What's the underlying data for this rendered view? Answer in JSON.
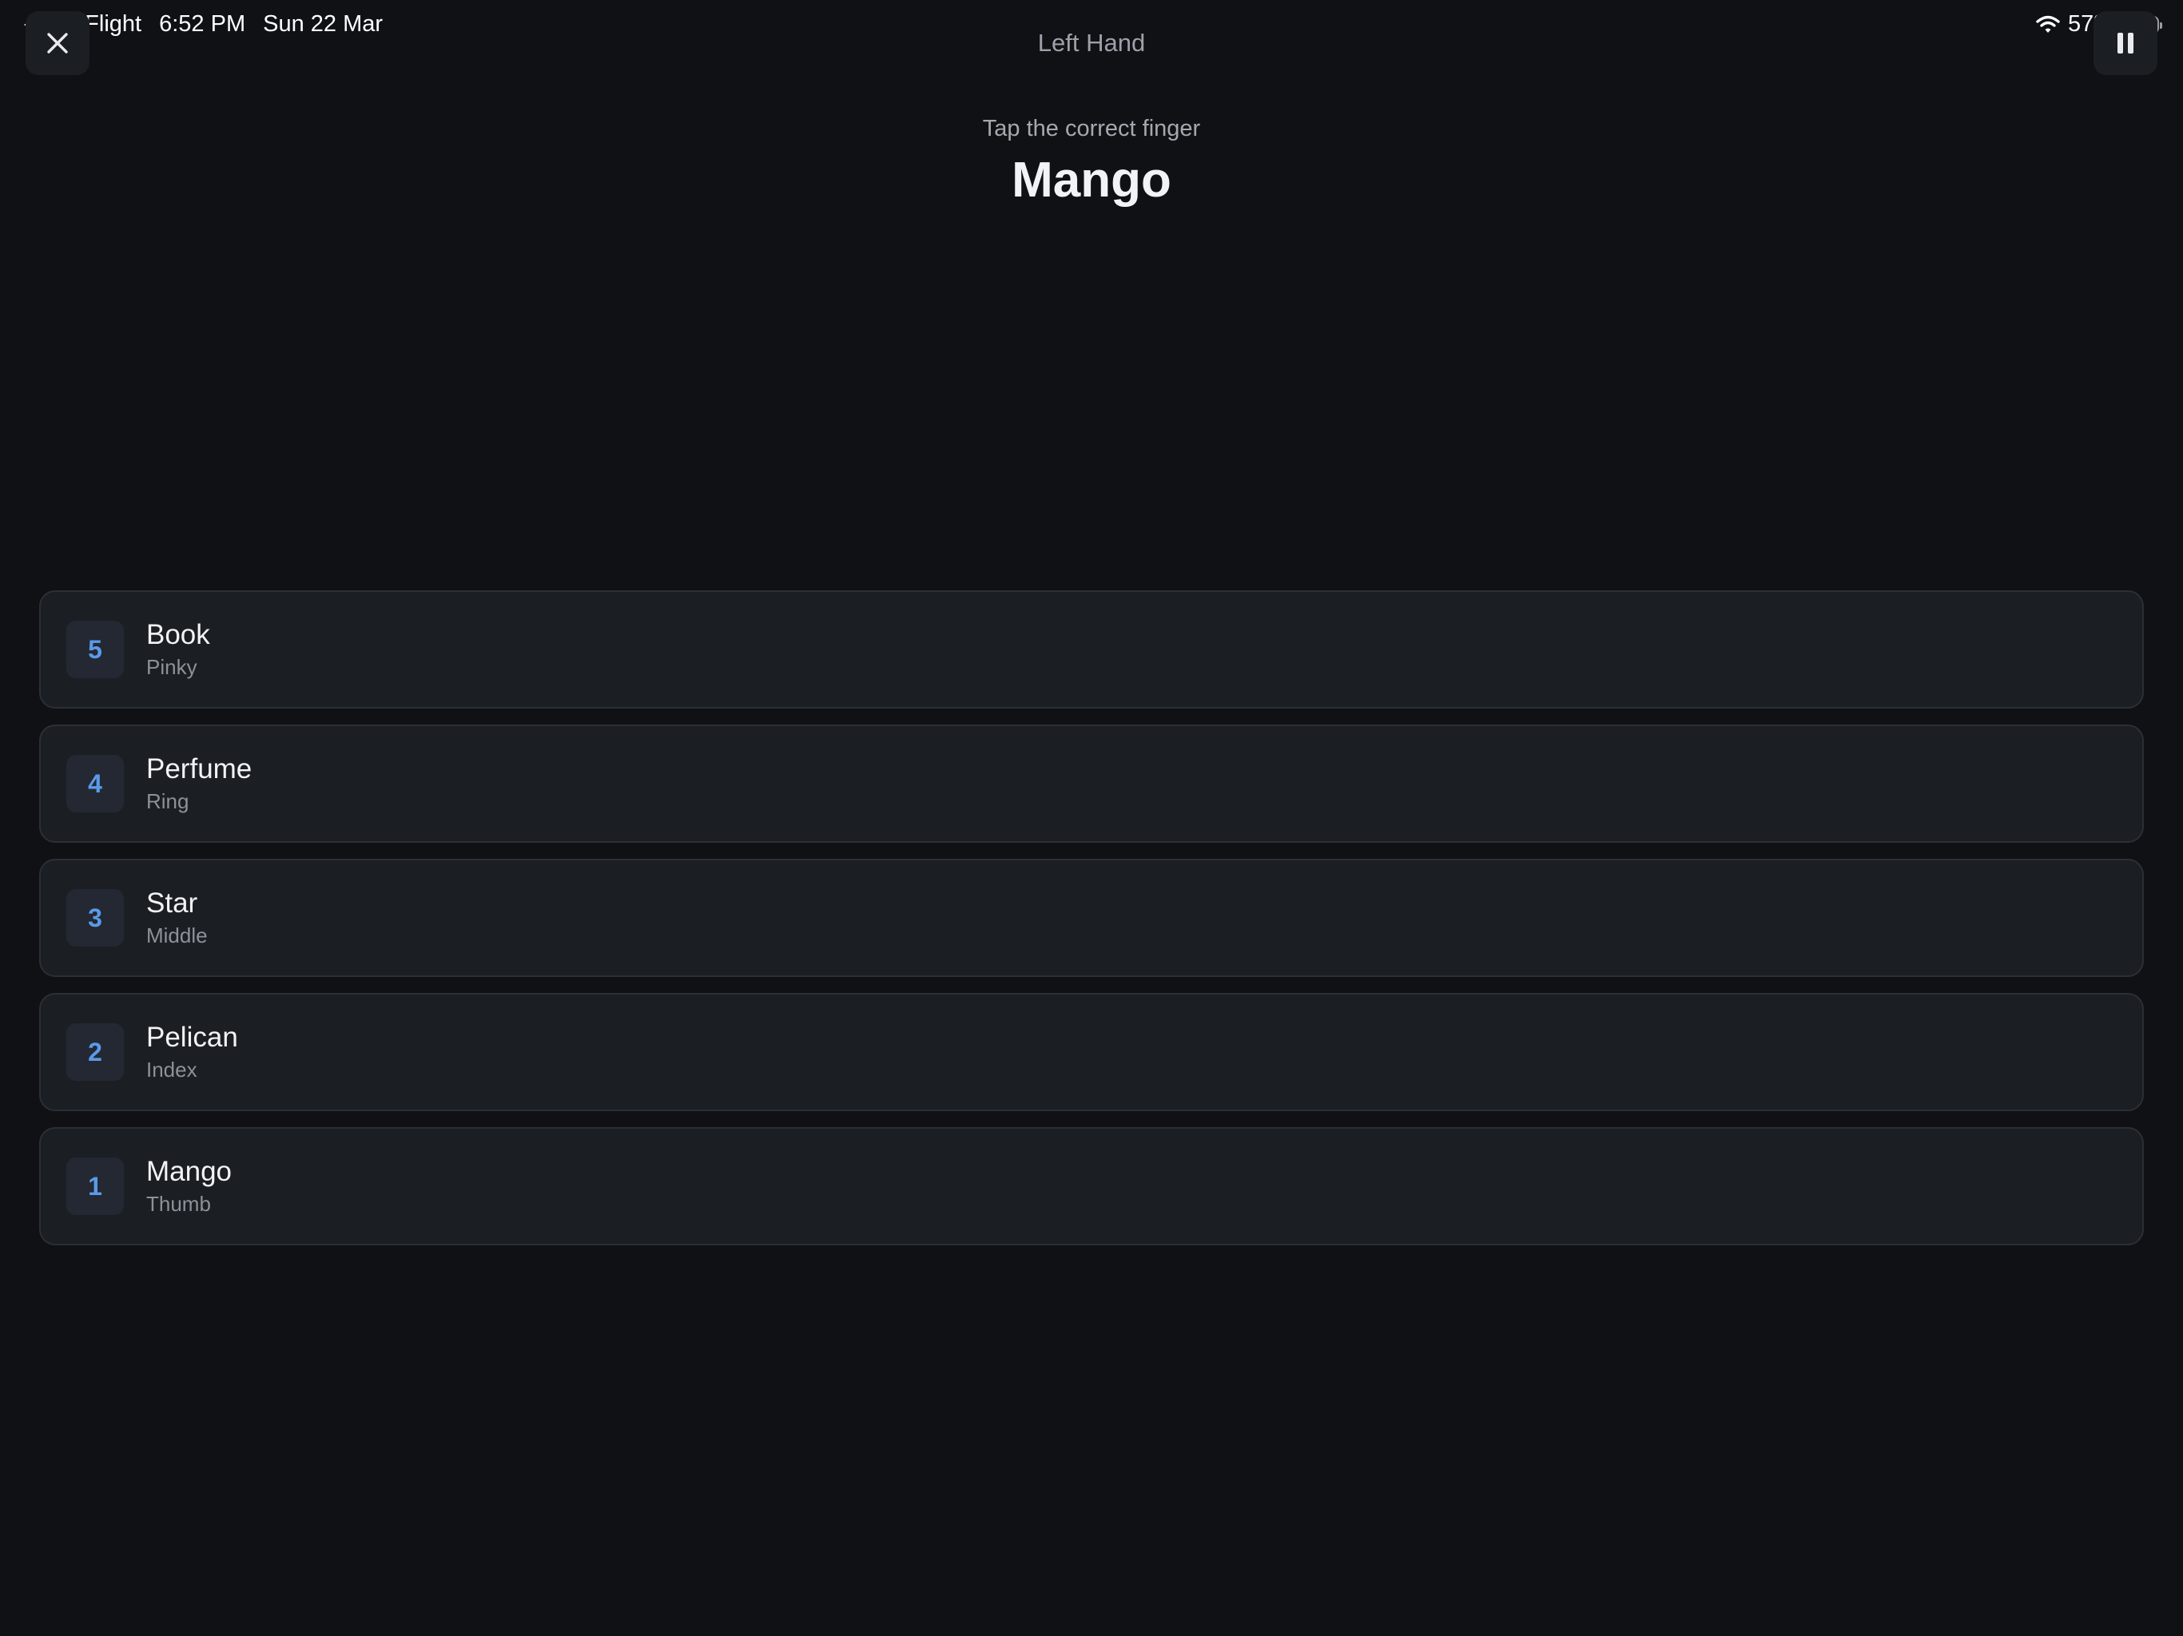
{
  "status_bar": {
    "back_app": "TestFlight",
    "time": "6:52 PM",
    "date": "Sun 22 Mar",
    "battery": "57%",
    "battery_level": 0.57
  },
  "header": {
    "title": "Left Hand"
  },
  "prompt": {
    "instruction": "Tap the correct finger",
    "word": "Mango"
  },
  "options": [
    {
      "number": "5",
      "word": "Book",
      "finger": "Pinky"
    },
    {
      "number": "4",
      "word": "Perfume",
      "finger": "Ring"
    },
    {
      "number": "3",
      "word": "Star",
      "finger": "Middle"
    },
    {
      "number": "2",
      "word": "Pelican",
      "finger": "Index"
    },
    {
      "number": "1",
      "word": "Mango",
      "finger": "Thumb"
    }
  ],
  "icons": {
    "close": "close-icon",
    "pause": "pause-icon",
    "back": "back-triangle-icon",
    "wifi": "wifi-icon",
    "battery": "battery-icon"
  },
  "colors": {
    "background": "#0f1115",
    "card": "#1b1e23",
    "accent": "#5b9ae8"
  }
}
